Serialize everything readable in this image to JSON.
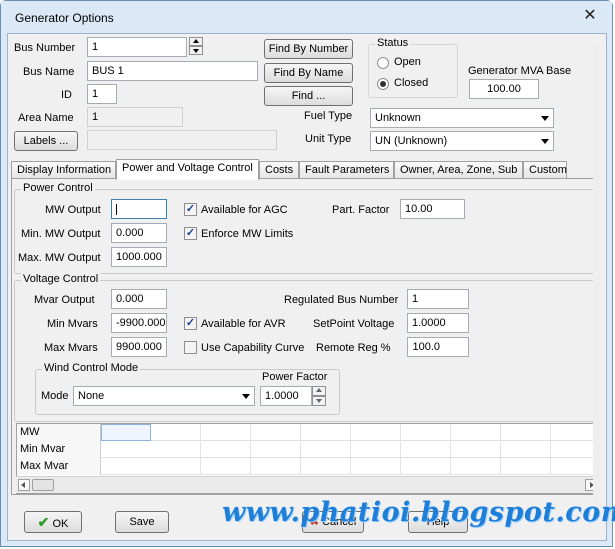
{
  "window": {
    "title": "Generator Options",
    "close_glyph": "✕"
  },
  "bus": {
    "bus_number_label": "Bus Number",
    "bus_number": "1",
    "bus_name_label": "Bus Name",
    "bus_name": "BUS 1",
    "id_label": "ID",
    "id": "1",
    "area_name_label": "Area Name",
    "area_name": "1",
    "labels_button": "Labels ...",
    "labels_value": ""
  },
  "find": {
    "by_number": "Find By Number",
    "by_name": "Find By Name",
    "find": "Find ..."
  },
  "status": {
    "title": "Status",
    "open": "Open",
    "closed": "Closed",
    "selected": "Closed"
  },
  "mva": {
    "label": "Generator MVA Base",
    "value": "100.00"
  },
  "fuel": {
    "fuel_label": "Fuel Type",
    "fuel_value": "Unknown",
    "unit_label": "Unit Type",
    "unit_value": "UN (Unknown)"
  },
  "tabs": [
    {
      "label": "Display Information"
    },
    {
      "label": "Power and Voltage Control"
    },
    {
      "label": "Costs"
    },
    {
      "label": "Fault Parameters"
    },
    {
      "label": "Owner, Area, Zone, Sub"
    },
    {
      "label": "Custom"
    }
  ],
  "selected_tab": "Power and Voltage Control",
  "power_control": {
    "title": "Power Control",
    "mw_output_label": "MW Output",
    "mw_output": "",
    "min_mw_label": "Min. MW Output",
    "min_mw": "0.000",
    "max_mw_label": "Max. MW Output",
    "max_mw": "1000.000",
    "agc_label": "Available for AGC",
    "agc_checked": true,
    "enforce_label": "Enforce MW Limits",
    "enforce_checked": true,
    "part_factor_label": "Part. Factor",
    "part_factor": "10.00"
  },
  "voltage_control": {
    "title": "Voltage Control",
    "mvar_output_label": "Mvar Output",
    "mvar_output": "0.000",
    "min_mvars_label": "Min Mvars",
    "min_mvars": "-9900.000",
    "max_mvars_label": "Max Mvars",
    "max_mvars": "9900.000",
    "avr_label": "Available for AVR",
    "avr_checked": true,
    "capability_label": "Use Capability Curve",
    "capability_checked": false,
    "reg_bus_label": "Regulated Bus Number",
    "reg_bus": "1",
    "setpoint_label": "SetPoint Voltage",
    "setpoint": "1.0000",
    "remote_reg_label": "Remote Reg %",
    "remote_reg": "100.0"
  },
  "wind": {
    "title": "Wind Control Mode",
    "mode_label": "Mode",
    "mode_value": "None",
    "power_factor_label": "Power Factor",
    "power_factor": "1.0000"
  },
  "grid_rows": [
    "MW",
    "Min Mvar",
    "Max Mvar"
  ],
  "buttons": {
    "ok": "OK",
    "save": "Save",
    "cancel": "Cancel",
    "help": "Help"
  },
  "icons": {
    "ok": "checkmark-icon",
    "cancel": "cancel-x-icon"
  },
  "watermark": "www.phatioi.blogspot.com",
  "colors": {
    "ok_check": "#2a9d2a",
    "cancel_x": "#c0392b",
    "watermark": "#1e7fd9"
  }
}
